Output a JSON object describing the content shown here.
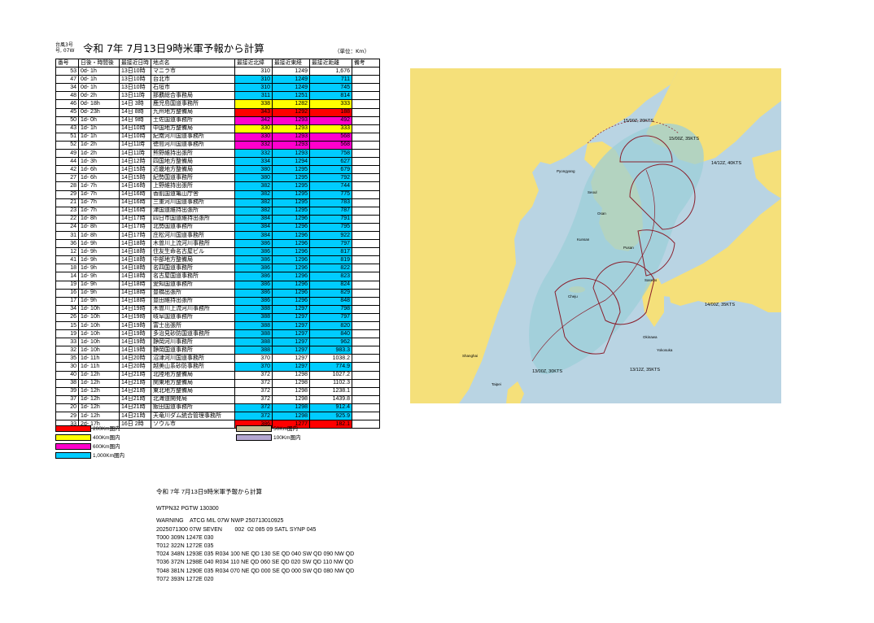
{
  "header": {
    "typhoon_label_line1": "台風3号",
    "typhoon_label_line2": "号, 07W",
    "title": "令和 7年 7月13日9時米軍予報から計算",
    "unit": "（単位：Km）"
  },
  "table": {
    "columns": [
      "番号",
      "日後・時間後",
      "最接近日時",
      "地点名",
      "最接近北緯",
      "最接近東経",
      "最接近距離",
      "備考"
    ],
    "rows": [
      {
        "no": "53",
        "after": "0d- 1h",
        "when": "13日10時",
        "place": "マニラ市",
        "lat": "310",
        "lon": "1249",
        "dist": "1,676"
      },
      {
        "no": "47",
        "after": "0d- 1h",
        "when": "13日10時",
        "place": "台北市",
        "lat": "310",
        "lon": "1249",
        "dist": "711"
      },
      {
        "no": "34",
        "after": "0d- 1h",
        "when": "13日10時",
        "place": "石垣市",
        "lat": "310",
        "lon": "1249",
        "dist": "745"
      },
      {
        "no": "48",
        "after": "0d- 2h",
        "when": "13日11時",
        "place": "那覇総合事務局",
        "lat": "311",
        "lon": "1251",
        "dist": "814"
      },
      {
        "no": "46",
        "after": "0d- 18h",
        "when": "14日 3時",
        "place": "鹿児島国道事務所",
        "lat": "338",
        "lon": "1282",
        "dist": "333"
      },
      {
        "no": "45",
        "after": "0d- 23h",
        "when": "14日 8時",
        "place": "九州地方整備局",
        "lat": "343",
        "lon": "1292",
        "dist": "188"
      },
      {
        "no": "50",
        "after": "1d- 0h",
        "when": "14日 9時",
        "place": "土佐国道事務所",
        "lat": "342",
        "lon": "1293",
        "dist": "492"
      },
      {
        "no": "43",
        "after": "1d- 1h",
        "when": "14日10時",
        "place": "中国地方整備局",
        "lat": "330",
        "lon": "1293",
        "dist": "333"
      },
      {
        "no": "51",
        "after": "1d- 1h",
        "when": "14日10時",
        "place": "紀南河川国道事務所",
        "lat": "330",
        "lon": "1293",
        "dist": "568"
      },
      {
        "no": "52",
        "after": "1d- 2h",
        "when": "14日11時",
        "place": "徳島河川国道事務所",
        "lat": "332",
        "lon": "1293",
        "dist": "568"
      },
      {
        "no": "49",
        "after": "1d- 2h",
        "when": "14日11時",
        "place": "熊野維持出張所",
        "lat": "332",
        "lon": "1293",
        "dist": "758"
      },
      {
        "no": "44",
        "after": "1d- 3h",
        "when": "14日12時",
        "place": "四国地方整備局",
        "lat": "334",
        "lon": "1294",
        "dist": "627"
      },
      {
        "no": "42",
        "after": "1d- 6h",
        "when": "14日15時",
        "place": "近畿地方整備局",
        "lat": "380",
        "lon": "1295",
        "dist": "679"
      },
      {
        "no": "27",
        "after": "1d- 6h",
        "when": "14日15時",
        "place": "紀勢国道事務所",
        "lat": "380",
        "lon": "1295",
        "dist": "792"
      },
      {
        "no": "28",
        "after": "1d- 7h",
        "when": "14日16時",
        "place": "上野維持出張所",
        "lat": "382",
        "lon": "1295",
        "dist": "744"
      },
      {
        "no": "29",
        "after": "1d- 7h",
        "when": "14日16時",
        "place": "香肌国道亀山庁舎",
        "lat": "382",
        "lon": "1295",
        "dist": "775"
      },
      {
        "no": "21",
        "after": "1d- 7h",
        "when": "14日16時",
        "place": "三重河川国道事務所",
        "lat": "382",
        "lon": "1295",
        "dist": "783"
      },
      {
        "no": "23",
        "after": "1d- 7h",
        "when": "14日16時",
        "place": "津国道維持出張所",
        "lat": "382",
        "lon": "1295",
        "dist": "787"
      },
      {
        "no": "22",
        "after": "1d- 8h",
        "when": "14日17時",
        "place": "四日市国道維持出張所",
        "lat": "384",
        "lon": "1296",
        "dist": "791"
      },
      {
        "no": "24",
        "after": "1d- 8h",
        "when": "14日17時",
        "place": "北勢国道事務所",
        "lat": "384",
        "lon": "1296",
        "dist": "795"
      },
      {
        "no": "31",
        "after": "1d- 8h",
        "when": "14日17時",
        "place": "庄松河川国道事務所",
        "lat": "384",
        "lon": "1296",
        "dist": "922"
      },
      {
        "no": "36",
        "after": "1d- 9h",
        "when": "14日18時",
        "place": "木曽川上流河川事務所",
        "lat": "386",
        "lon": "1296",
        "dist": "797"
      },
      {
        "no": "12",
        "after": "1d- 9h",
        "when": "14日18時",
        "place": "住友生命名古屋ビル",
        "lat": "386",
        "lon": "1296",
        "dist": "817"
      },
      {
        "no": "41",
        "after": "1d- 9h",
        "when": "14日18時",
        "place": "中部地方整備局",
        "lat": "386",
        "lon": "1296",
        "dist": "819"
      },
      {
        "no": "18",
        "after": "1d- 9h",
        "when": "14日18時",
        "place": "名四国道事務所",
        "lat": "386",
        "lon": "1296",
        "dist": "822"
      },
      {
        "no": "14",
        "after": "1d- 9h",
        "when": "14日18時",
        "place": "名古屋国道事務所",
        "lat": "386",
        "lon": "1296",
        "dist": "823"
      },
      {
        "no": "19",
        "after": "1d- 9h",
        "when": "14日18時",
        "place": "愛知国道事務所",
        "lat": "386",
        "lon": "1296",
        "dist": "824"
      },
      {
        "no": "16",
        "after": "1d- 9h",
        "when": "14日18時",
        "place": "豊橋出張所",
        "lat": "386",
        "lon": "1296",
        "dist": "829"
      },
      {
        "no": "17",
        "after": "1d- 9h",
        "when": "14日18時",
        "place": "豊田維持出張所",
        "lat": "386",
        "lon": "1296",
        "dist": "848"
      },
      {
        "no": "34",
        "after": "1d- 10h",
        "when": "14日19時",
        "place": "木曽川上流河川事務所",
        "lat": "388",
        "lon": "1297",
        "dist": "798"
      },
      {
        "no": "26",
        "after": "1d- 10h",
        "when": "14日19時",
        "place": "岐阜国道事務所",
        "lat": "388",
        "lon": "1297",
        "dist": "797"
      },
      {
        "no": "15",
        "after": "1d- 10h",
        "when": "14日19時",
        "place": "富士出張所",
        "lat": "388",
        "lon": "1297",
        "dist": "820"
      },
      {
        "no": "19",
        "after": "1d- 10h",
        "when": "14日19時",
        "place": "多治見砂防国道事務所",
        "lat": "388",
        "lon": "1297",
        "dist": "840"
      },
      {
        "no": "33",
        "after": "1d- 10h",
        "when": "14日19時",
        "place": "静岡河川事務所",
        "lat": "388",
        "lon": "1297",
        "dist": "962"
      },
      {
        "no": "32",
        "after": "1d- 10h",
        "when": "14日19時",
        "place": "静岡国道事務所",
        "lat": "388",
        "lon": "1297",
        "dist": "983.3"
      },
      {
        "no": "35",
        "after": "1d- 11h",
        "when": "14日20時",
        "place": "沼津河川国道事務所",
        "lat": "370",
        "lon": "1297",
        "dist": "1038.2"
      },
      {
        "no": "30",
        "after": "1d- 11h",
        "when": "14日20時",
        "place": "越美山系砂防事務所",
        "lat": "370",
        "lon": "1297",
        "dist": "774.9"
      },
      {
        "no": "40",
        "after": "1d- 12h",
        "when": "14日21時",
        "place": "北陸地方整備局",
        "lat": "372",
        "lon": "1298",
        "dist": "1027.2"
      },
      {
        "no": "38",
        "after": "1d- 12h",
        "when": "14日21時",
        "place": "関東地方整備局",
        "lat": "372",
        "lon": "1298",
        "dist": "1102.3"
      },
      {
        "no": "39",
        "after": "1d- 12h",
        "when": "14日21時",
        "place": "東北地方整備局",
        "lat": "372",
        "lon": "1298",
        "dist": "1238.1"
      },
      {
        "no": "37",
        "after": "1d- 12h",
        "when": "14日21時",
        "place": "北海道開発局",
        "lat": "372",
        "lon": "1298",
        "dist": "1439.8"
      },
      {
        "no": "20",
        "after": "1d- 12h",
        "when": "14日21時",
        "place": "飯田国道事務所",
        "lat": "372",
        "lon": "1298",
        "dist": "912.4"
      },
      {
        "no": "29",
        "after": "1d- 12h",
        "when": "14日21時",
        "place": "天竜川ダム統合管理事務所",
        "lat": "372",
        "lon": "1298",
        "dist": "925.9"
      },
      {
        "no": "33",
        "after": "2d- 17h",
        "when": "16日 2時",
        "place": "ソウル市",
        "lat": "386",
        "lon": "1277",
        "dist": "182.1"
      }
    ]
  },
  "colors": {
    "r200": "#ff0000",
    "r400": "#ffff00",
    "r600": "#ff00cc",
    "r1000": "#00ccff",
    "r50": "#c5bb93",
    "r100": "#b4a7d0",
    "sea": "#b9d4e3",
    "land": "#f5e07a",
    "cone": "#9ccfd8",
    "track": "#8a1f2d"
  },
  "legend": {
    "r200": "200Km圏内",
    "r400": "400Km圏内",
    "r600": "600Km圏内",
    "r1000": "1,000Km圏内",
    "r50": "50Km圏内",
    "r100": "100Km圏内"
  },
  "map": {
    "labels": {
      "t1": "15/00Z, 20KTS",
      "t2": "15/00Z, 35KTS",
      "t3": "14/12Z, 40KTS",
      "t4": "14/00Z, 35KTS",
      "t5": "13/12Z, 35KTS",
      "t6": "13/00Z, 30KTS"
    },
    "cities": {
      "c1": "Pyongyang",
      "c2": "Seoul",
      "c3": "Kunsan",
      "c4": "Pusan",
      "c5": "Osan",
      "c6": "Cheju",
      "c7": "Sasebo",
      "c8": "Okinawa",
      "c9": "Yokosuka",
      "c10": "Shanghai",
      "c11": "Taipei"
    }
  },
  "warning": {
    "title": "令和 7年 7月13日9時米軍予報から計算",
    "lines": [
      "WTPN32 PGTW 130300",
      "WARNING    ATCG MIL 07W NWP 250713010925",
      "2025071300 07W SEVEN        002  02 085 09 SATL SYNP 045",
      "T000 309N 1247E 030",
      "T012 322N 1272E 035",
      "T024 348N 1293E 035 R034 100 NE QD 130 SE QD 040 SW QD 090 NW QD",
      "T036 372N 1298E 040 R034 110 NE QD 060 SE QD 020 SW QD 110 NW QD",
      "T048 381N 1290E 035 R034 070 NE QD 000 SE QD 000 SW QD 080 NW QD",
      "T072 393N 1272E 020"
    ]
  }
}
